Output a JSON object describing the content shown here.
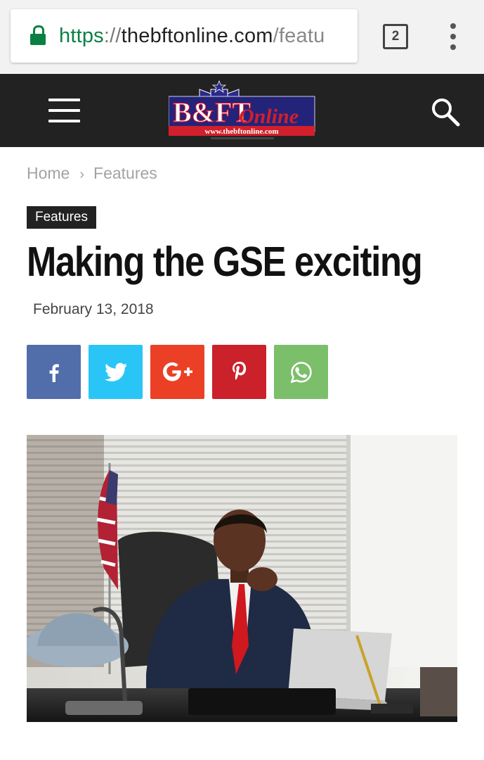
{
  "browser": {
    "url_scheme": "https",
    "url_separator": "://",
    "url_host": "thebftonline.com",
    "url_path": "/featu",
    "tab_count": "2",
    "secure_color": "#0b8043"
  },
  "site": {
    "logo_text": "B&FT",
    "logo_script": "Online",
    "logo_url": "www.thebftonline.com",
    "header_color": "#222222"
  },
  "breadcrumb": {
    "home": "Home",
    "separator": "›",
    "current": "Features"
  },
  "article": {
    "category": "Features",
    "title": "Making the GSE exciting",
    "date": "February 13, 2018"
  },
  "share": [
    {
      "icon": "facebook-icon",
      "color": "#516eab"
    },
    {
      "icon": "twitter-icon",
      "color": "#29c5f6"
    },
    {
      "icon": "google-plus-icon",
      "color": "#eb4026"
    },
    {
      "icon": "pinterest-icon",
      "color": "#ca212a"
    },
    {
      "icon": "whatsapp-icon",
      "color": "#7bbf6a"
    }
  ],
  "hero_image": "photo of a man in a suit and red tie seated at an office desk with a laptop and a US flag behind him"
}
